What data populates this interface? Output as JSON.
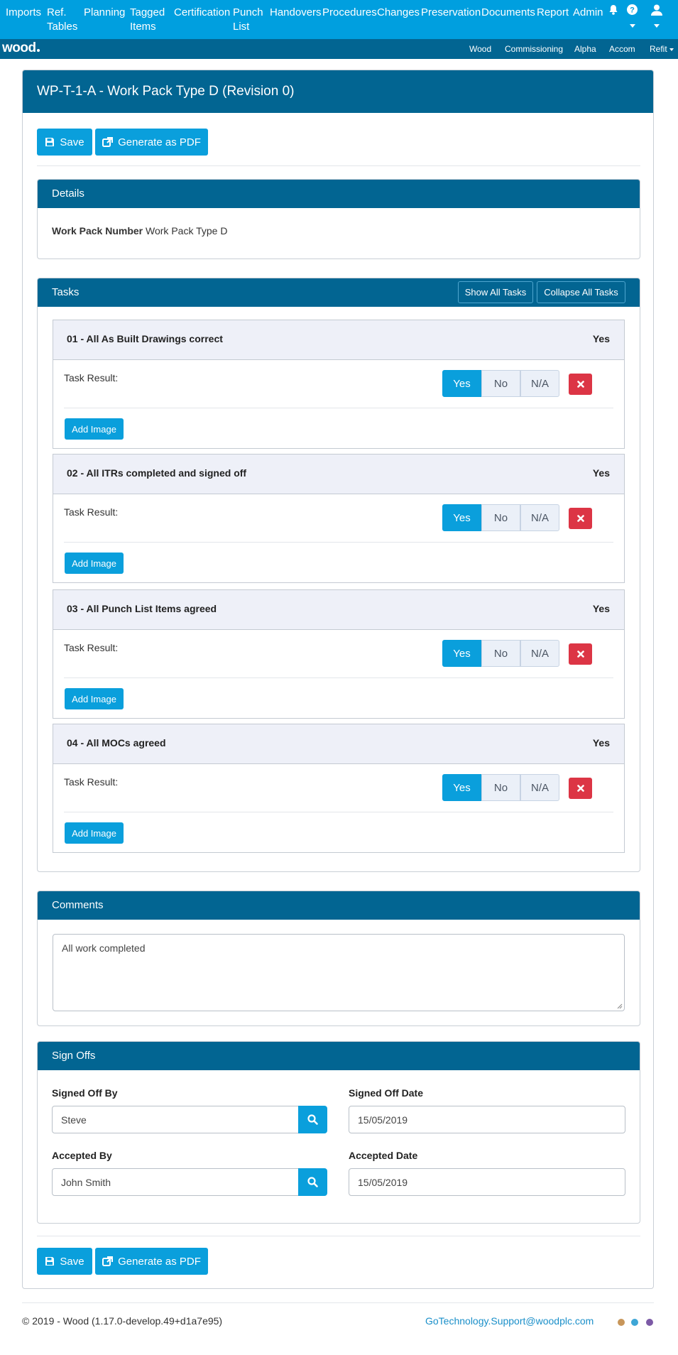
{
  "nav": {
    "items": [
      "Imports",
      "Ref.\nTables",
      "Planning",
      "Tagged\nItems",
      "Certification",
      "Punch\nList",
      "Handovers",
      "Procedures",
      "Changes",
      "Preservation",
      "Documents",
      "Report",
      "Admin"
    ],
    "icons": [
      "bell-icon",
      "help-icon",
      "user-icon"
    ]
  },
  "subnav": {
    "logo": "wood",
    "items": [
      "Wood",
      "Commissioning",
      "Alpha",
      "Accom",
      "Refit"
    ]
  },
  "page": {
    "title": "WP-T-1-A - Work Pack Type D (Revision 0)",
    "save_label": "Save",
    "pdf_label": "Generate as PDF"
  },
  "details": {
    "title": "Details",
    "field_label": "Work Pack Number",
    "field_value": "Work Pack Type D"
  },
  "tasks": {
    "title": "Tasks",
    "show_all": "Show All Tasks",
    "collapse_all": "Collapse All Tasks",
    "result_label": "Task Result:",
    "options": [
      "Yes",
      "No",
      "N/A"
    ],
    "add_image": "Add Image",
    "items": [
      {
        "title": "01 - All As Built Drawings correct",
        "status": "Yes",
        "selected": "Yes"
      },
      {
        "title": "02 - All ITRs completed and signed off",
        "status": "Yes",
        "selected": "Yes"
      },
      {
        "title": "03 - All Punch List Items agreed",
        "status": "Yes",
        "selected": "Yes"
      },
      {
        "title": "04 - All MOCs agreed",
        "status": "Yes",
        "selected": "Yes"
      }
    ]
  },
  "comments": {
    "title": "Comments",
    "value": "All work completed"
  },
  "signoffs": {
    "title": "Sign Offs",
    "signed_off_by_label": "Signed Off By",
    "signed_off_by_value": "Steve",
    "signed_off_date_label": "Signed Off Date",
    "signed_off_date_value": "15/05/2019",
    "accepted_by_label": "Accepted By",
    "accepted_by_value": "John Smith",
    "accepted_date_label": "Accepted Date",
    "accepted_date_value": "15/05/2019"
  },
  "footer": {
    "copyright": "© 2019 - Wood (1.17.0-develop.49+d1a7e95)",
    "email": "GoTechnology.Support@woodplc.com",
    "dot_colors": [
      "#c8965a",
      "#3ea6d6",
      "#7c5aa6"
    ]
  },
  "colors": {
    "nav": "#009fdf",
    "header": "#026592",
    "button": "#0a9fdc",
    "danger": "#dc3545"
  }
}
